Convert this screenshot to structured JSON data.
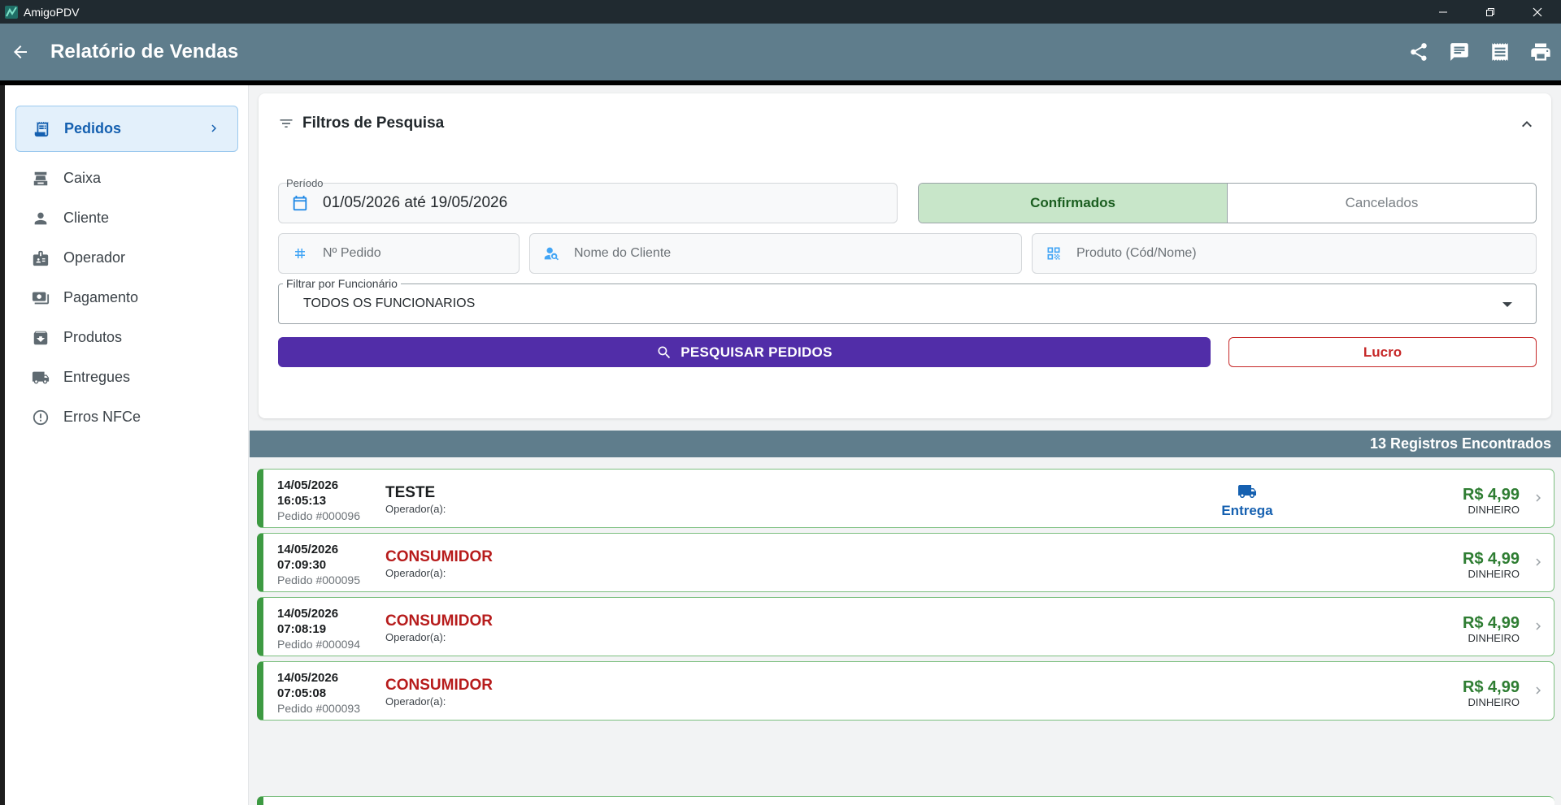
{
  "window": {
    "title": "AmigoPDV"
  },
  "appbar": {
    "title": "Relatório de Vendas"
  },
  "sidebar": {
    "items": [
      {
        "label": "Pedidos",
        "icon": "receipt-icon",
        "active": true
      },
      {
        "label": "Caixa",
        "icon": "cash-register-icon"
      },
      {
        "label": "Cliente",
        "icon": "person-icon"
      },
      {
        "label": "Operador",
        "icon": "badge-icon"
      },
      {
        "label": "Pagamento",
        "icon": "payment-icon"
      },
      {
        "label": "Produtos",
        "icon": "archive-icon"
      },
      {
        "label": "Entregues",
        "icon": "truck-icon"
      },
      {
        "label": "Erros NFCe",
        "icon": "error-icon"
      }
    ]
  },
  "filters": {
    "title": "Filtros de Pesquisa",
    "period_label": "Período",
    "period_value": "01/05/2026 até 19/05/2026",
    "status_confirmed": "Confirmados",
    "status_cancelled": "Cancelados",
    "order_number_placeholder": "Nº Pedido",
    "customer_placeholder": "Nome do Cliente",
    "product_placeholder": "Produto (Cód/Nome)",
    "employee_label": "Filtrar por Funcionário",
    "employee_value": "TODOS OS FUNCIONARIOS",
    "search_button": "PESQUISAR PEDIDOS",
    "profit_button": "Lucro"
  },
  "results": {
    "count_text": "13 Registros Encontrados",
    "orders": [
      {
        "date": "14/05/2026",
        "time": "16:05:13",
        "number": "Pedido #000096",
        "customer": "TESTE",
        "operator": "Operador(a):",
        "delivery": "Entrega",
        "price": "R$ 4,99",
        "payment": "DINHEIRO"
      },
      {
        "date": "14/05/2026",
        "time": "07:09:30",
        "number": "Pedido #000095",
        "customer": "CONSUMIDOR",
        "operator": "Operador(a):",
        "price": "R$ 4,99",
        "payment": "DINHEIRO"
      },
      {
        "date": "14/05/2026",
        "time": "07:08:19",
        "number": "Pedido #000094",
        "customer": "CONSUMIDOR",
        "operator": "Operador(a):",
        "price": "R$ 4,99",
        "payment": "DINHEIRO"
      },
      {
        "date": "14/05/2026",
        "time": "07:05:08",
        "number": "Pedido #000093",
        "customer": "CONSUMIDOR",
        "operator": "Operador(a):",
        "price": "R$ 4,99",
        "payment": "DINHEIRO"
      }
    ]
  },
  "colors": {
    "appbar": "#5f7d8c",
    "primary_button": "#512da8",
    "success": "#2e7d32",
    "danger": "#c62828",
    "consumer_text": "#b71c1c",
    "link_blue": "#1560b0"
  }
}
